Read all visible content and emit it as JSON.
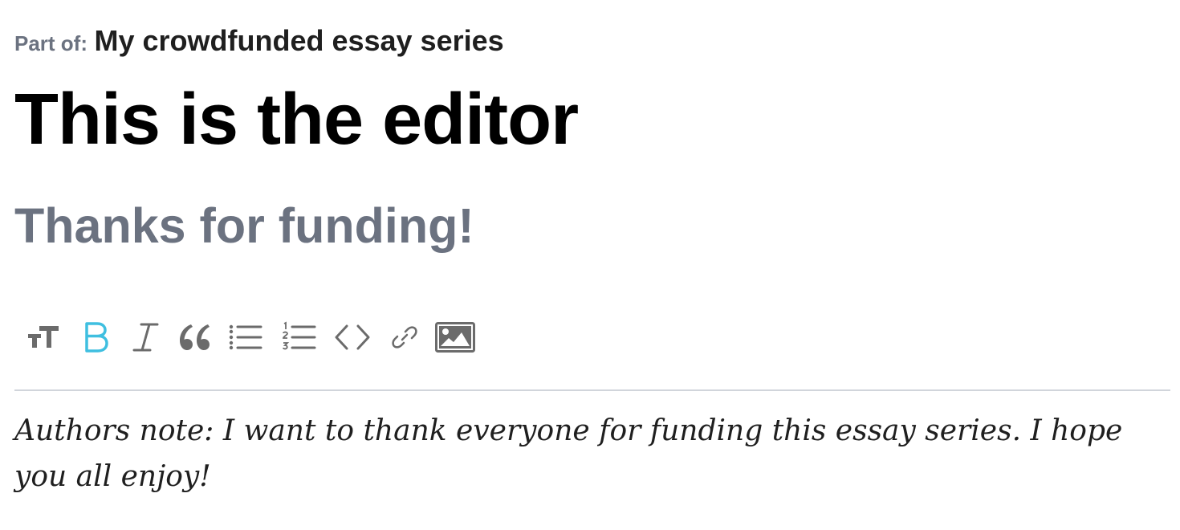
{
  "series": {
    "prefix": "Part of:",
    "name": "My crowdfunded essay series"
  },
  "post": {
    "title": "This is the editor",
    "subtitle": "Thanks for funding!",
    "body": "Authors note: I want to thank everyone for funding this essay series. I hope you all enjoy!"
  },
  "toolbar": {
    "buttons": [
      {
        "icon": "text-size-icon",
        "active": false
      },
      {
        "icon": "bold-icon",
        "active": true
      },
      {
        "icon": "italic-icon",
        "active": false
      },
      {
        "icon": "quote-icon",
        "active": false
      },
      {
        "icon": "bulleted-list-icon",
        "active": false
      },
      {
        "icon": "numbered-list-icon",
        "active": false
      },
      {
        "icon": "code-icon",
        "active": false
      },
      {
        "icon": "link-icon",
        "active": false
      },
      {
        "icon": "image-icon",
        "active": false
      }
    ]
  },
  "colors": {
    "icon": "#6b6b6b",
    "active": "#3fbfe0",
    "muted_text": "#6b7280",
    "divider": "#d1d5db"
  }
}
